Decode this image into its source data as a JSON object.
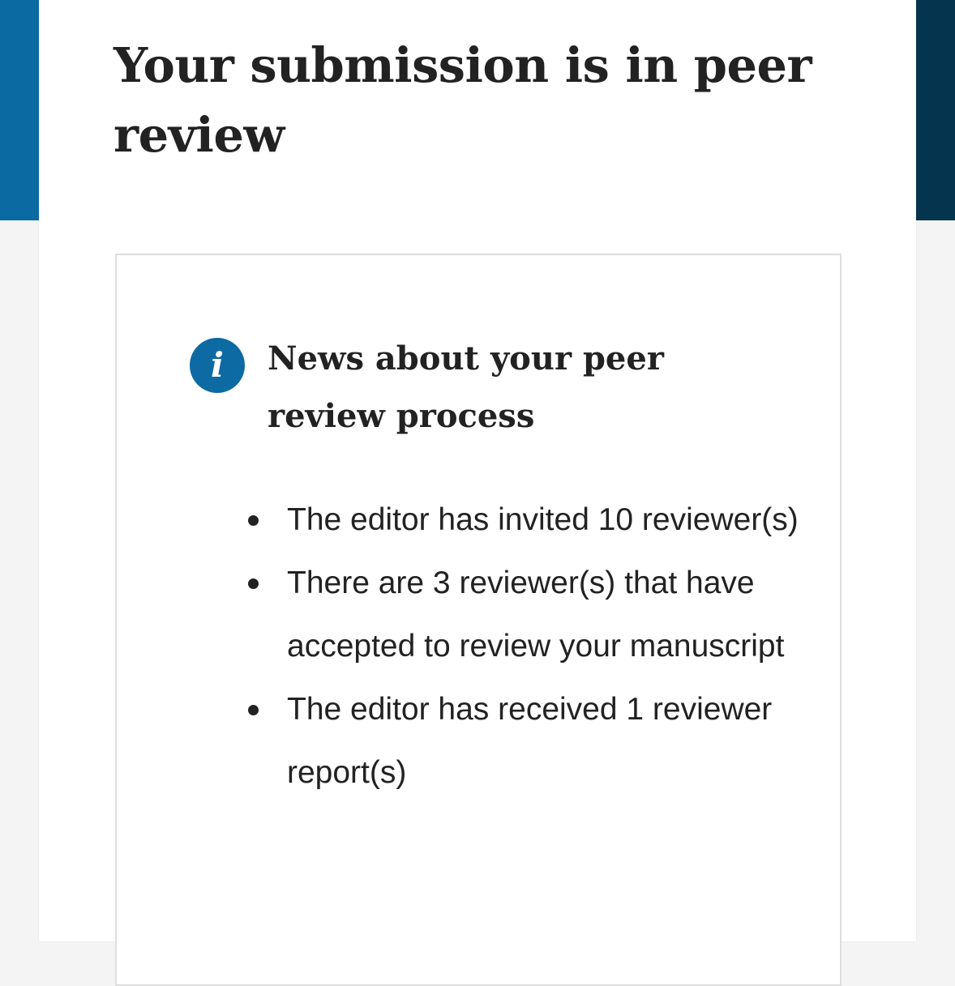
{
  "colors": {
    "left_band": "#0b6aa2",
    "right_band": "#05344f",
    "info_icon": "#0d6aa3",
    "text": "#222222"
  },
  "page": {
    "title": "Your submission is in peer review"
  },
  "news": {
    "icon": "info-icon",
    "icon_glyph": "i",
    "heading": "News about your peer review process",
    "items": [
      "The editor has invited 10 reviewer(s)",
      "There are 3 reviewer(s) that have accepted to review your manuscript",
      "The editor has received 1 reviewer report(s)"
    ]
  }
}
